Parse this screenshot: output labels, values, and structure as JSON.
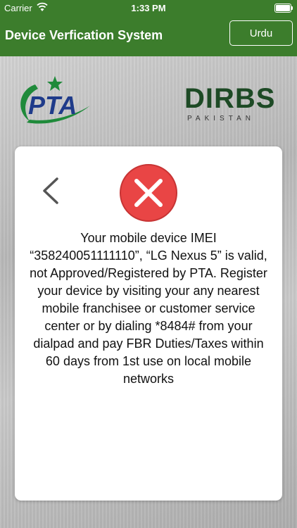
{
  "status_bar": {
    "carrier": "Carrier",
    "time": "1:33 PM",
    "wifi_icon": "wifi-icon",
    "battery_icon": "battery-icon"
  },
  "nav": {
    "title": "Device Verfication System",
    "language_button": "Urdu"
  },
  "logos": {
    "pta_text": "PTA",
    "dirbs_text": "DIRBS",
    "dirbs_subtext": "PAKISTAN"
  },
  "result": {
    "status_icon": "error-x-icon",
    "back_icon": "chevron-left-icon",
    "message": "Your mobile device IMEI “358240051111110”, “LG Nexus 5” is valid, not Approved/Registered by PTA. Register your device by visiting your any nearest mobile franchisee or customer service center or by dialing *8484# from your dialpad and pay FBR Duties/Taxes within 60 days from 1st use on local mobile networks"
  },
  "colors": {
    "brand_green": "#3c7d2c",
    "error_red": "#e94545",
    "pta_blue": "#1f3b8a",
    "pta_green": "#1f8a3a"
  }
}
